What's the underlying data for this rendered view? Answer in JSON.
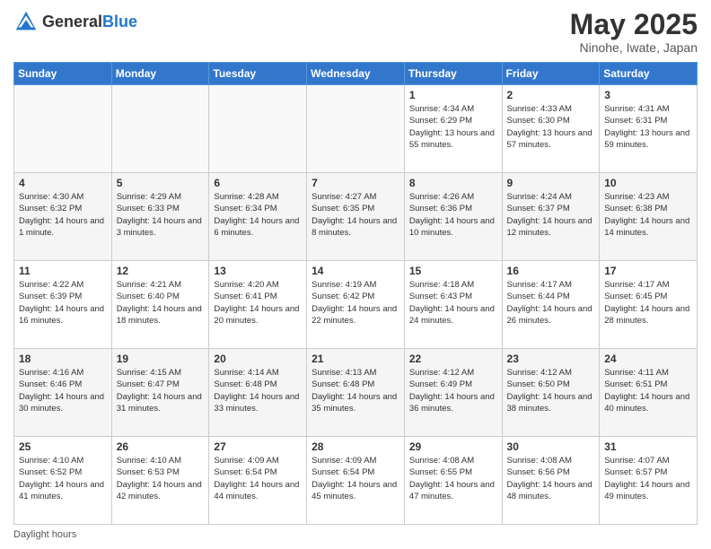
{
  "header": {
    "logo_general": "General",
    "logo_blue": "Blue",
    "month_title": "May 2025",
    "subtitle": "Ninohe, Iwate, Japan"
  },
  "footer": {
    "note": "Daylight hours"
  },
  "days_of_week": [
    "Sunday",
    "Monday",
    "Tuesday",
    "Wednesday",
    "Thursday",
    "Friday",
    "Saturday"
  ],
  "weeks": [
    [
      {
        "day": "",
        "info": ""
      },
      {
        "day": "",
        "info": ""
      },
      {
        "day": "",
        "info": ""
      },
      {
        "day": "",
        "info": ""
      },
      {
        "day": "1",
        "info": "Sunrise: 4:34 AM\nSunset: 6:29 PM\nDaylight: 13 hours\nand 55 minutes."
      },
      {
        "day": "2",
        "info": "Sunrise: 4:33 AM\nSunset: 6:30 PM\nDaylight: 13 hours\nand 57 minutes."
      },
      {
        "day": "3",
        "info": "Sunrise: 4:31 AM\nSunset: 6:31 PM\nDaylight: 13 hours\nand 59 minutes."
      }
    ],
    [
      {
        "day": "4",
        "info": "Sunrise: 4:30 AM\nSunset: 6:32 PM\nDaylight: 14 hours\nand 1 minute."
      },
      {
        "day": "5",
        "info": "Sunrise: 4:29 AM\nSunset: 6:33 PM\nDaylight: 14 hours\nand 3 minutes."
      },
      {
        "day": "6",
        "info": "Sunrise: 4:28 AM\nSunset: 6:34 PM\nDaylight: 14 hours\nand 6 minutes."
      },
      {
        "day": "7",
        "info": "Sunrise: 4:27 AM\nSunset: 6:35 PM\nDaylight: 14 hours\nand 8 minutes."
      },
      {
        "day": "8",
        "info": "Sunrise: 4:26 AM\nSunset: 6:36 PM\nDaylight: 14 hours\nand 10 minutes."
      },
      {
        "day": "9",
        "info": "Sunrise: 4:24 AM\nSunset: 6:37 PM\nDaylight: 14 hours\nand 12 minutes."
      },
      {
        "day": "10",
        "info": "Sunrise: 4:23 AM\nSunset: 6:38 PM\nDaylight: 14 hours\nand 14 minutes."
      }
    ],
    [
      {
        "day": "11",
        "info": "Sunrise: 4:22 AM\nSunset: 6:39 PM\nDaylight: 14 hours\nand 16 minutes."
      },
      {
        "day": "12",
        "info": "Sunrise: 4:21 AM\nSunset: 6:40 PM\nDaylight: 14 hours\nand 18 minutes."
      },
      {
        "day": "13",
        "info": "Sunrise: 4:20 AM\nSunset: 6:41 PM\nDaylight: 14 hours\nand 20 minutes."
      },
      {
        "day": "14",
        "info": "Sunrise: 4:19 AM\nSunset: 6:42 PM\nDaylight: 14 hours\nand 22 minutes."
      },
      {
        "day": "15",
        "info": "Sunrise: 4:18 AM\nSunset: 6:43 PM\nDaylight: 14 hours\nand 24 minutes."
      },
      {
        "day": "16",
        "info": "Sunrise: 4:17 AM\nSunset: 6:44 PM\nDaylight: 14 hours\nand 26 minutes."
      },
      {
        "day": "17",
        "info": "Sunrise: 4:17 AM\nSunset: 6:45 PM\nDaylight: 14 hours\nand 28 minutes."
      }
    ],
    [
      {
        "day": "18",
        "info": "Sunrise: 4:16 AM\nSunset: 6:46 PM\nDaylight: 14 hours\nand 30 minutes."
      },
      {
        "day": "19",
        "info": "Sunrise: 4:15 AM\nSunset: 6:47 PM\nDaylight: 14 hours\nand 31 minutes."
      },
      {
        "day": "20",
        "info": "Sunrise: 4:14 AM\nSunset: 6:48 PM\nDaylight: 14 hours\nand 33 minutes."
      },
      {
        "day": "21",
        "info": "Sunrise: 4:13 AM\nSunset: 6:48 PM\nDaylight: 14 hours\nand 35 minutes."
      },
      {
        "day": "22",
        "info": "Sunrise: 4:12 AM\nSunset: 6:49 PM\nDaylight: 14 hours\nand 36 minutes."
      },
      {
        "day": "23",
        "info": "Sunrise: 4:12 AM\nSunset: 6:50 PM\nDaylight: 14 hours\nand 38 minutes."
      },
      {
        "day": "24",
        "info": "Sunrise: 4:11 AM\nSunset: 6:51 PM\nDaylight: 14 hours\nand 40 minutes."
      }
    ],
    [
      {
        "day": "25",
        "info": "Sunrise: 4:10 AM\nSunset: 6:52 PM\nDaylight: 14 hours\nand 41 minutes."
      },
      {
        "day": "26",
        "info": "Sunrise: 4:10 AM\nSunset: 6:53 PM\nDaylight: 14 hours\nand 42 minutes."
      },
      {
        "day": "27",
        "info": "Sunrise: 4:09 AM\nSunset: 6:54 PM\nDaylight: 14 hours\nand 44 minutes."
      },
      {
        "day": "28",
        "info": "Sunrise: 4:09 AM\nSunset: 6:54 PM\nDaylight: 14 hours\nand 45 minutes."
      },
      {
        "day": "29",
        "info": "Sunrise: 4:08 AM\nSunset: 6:55 PM\nDaylight: 14 hours\nand 47 minutes."
      },
      {
        "day": "30",
        "info": "Sunrise: 4:08 AM\nSunset: 6:56 PM\nDaylight: 14 hours\nand 48 minutes."
      },
      {
        "day": "31",
        "info": "Sunrise: 4:07 AM\nSunset: 6:57 PM\nDaylight: 14 hours\nand 49 minutes."
      }
    ]
  ]
}
